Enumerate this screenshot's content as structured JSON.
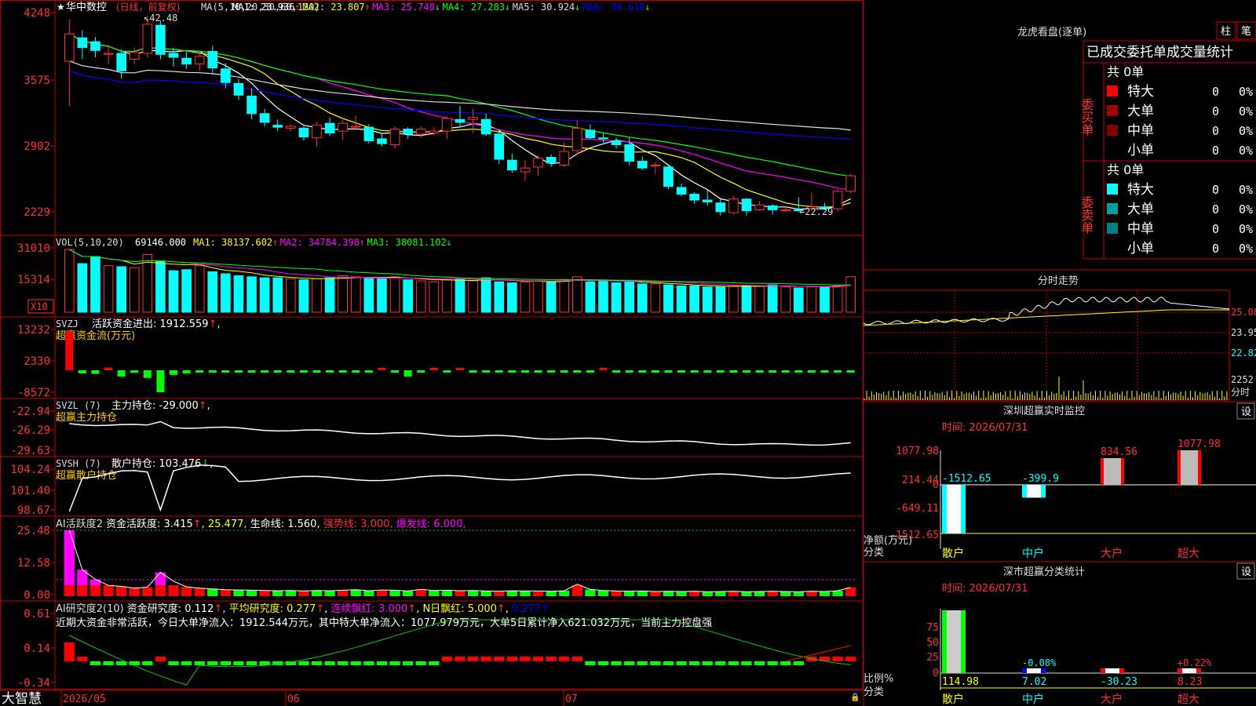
{
  "stock": {
    "name": "华中数控",
    "period": "(日线，前复权)"
  },
  "main_panel": {
    "ma_label": "MA(5,10,20,30,60,120)",
    "ma_items": [
      {
        "name": "MA1",
        "value": "23.936",
        "arrow": "↑",
        "color": "#ffffff"
      },
      {
        "name": "MA2",
        "value": "23.807",
        "arrow": "↑",
        "color": "#ffff00"
      },
      {
        "name": "MA3",
        "value": "25.748",
        "arrow": "↓",
        "color": "#ff00ff"
      },
      {
        "name": "MA4",
        "value": "27.283",
        "arrow": "↓",
        "color": "#00ff00"
      },
      {
        "name": "MA5",
        "value": "30.924",
        "arrow": "↓",
        "color": "#dddddd"
      },
      {
        "name": "MA6",
        "value": "30.610",
        "arrow": "↓",
        "color": "#0000ff"
      }
    ],
    "ticks": [
      "4248",
      "3575",
      "2902",
      "2229"
    ],
    "high_label": "42.48",
    "low_label": "←22.29"
  },
  "vol_panel": {
    "label": "VOL(5,10,20)",
    "value": "69146.000",
    "items": [
      {
        "name": "MA1",
        "value": "38137.602",
        "arrow": "↑",
        "color": "#ffff00"
      },
      {
        "name": "MA2",
        "value": "34784.398",
        "arrow": "↑",
        "color": "#ff00ff"
      },
      {
        "name": "MA3",
        "value": "38081.102",
        "arrow": "↓",
        "color": "#00ff00"
      }
    ],
    "ticks": [
      "31010",
      "15314"
    ],
    "unit_label": "X10"
  },
  "svzj_panel": {
    "label": "SVZJ",
    "name": "活跃资金进出",
    "value": "1912.559",
    "arrow": "↑",
    "subtitle": "超赢资金流(万元)",
    "ticks": [
      "13232",
      "2330",
      "-8572"
    ]
  },
  "svzl_panel": {
    "label": "SVZL (7)",
    "name": "主力持仓",
    "value": "-29.000",
    "arrow": "↑",
    "subtitle": "超赢主力持仓",
    "ticks": [
      "-22.94",
      "-26.29",
      "-29.63"
    ]
  },
  "svsh_panel": {
    "label": "SVSH (7)",
    "name": "散户持仓",
    "value": "103.476",
    "arrow": "↓",
    "subtitle": "超赢散户持仓",
    "ticks": [
      "104.24",
      "101.40",
      "98.67"
    ]
  },
  "ai1_panel": {
    "label": "AI活跃度2",
    "name": "资金活跃度",
    "value": "3.415",
    "value2": "25.477",
    "life_label": "生命线",
    "life_value": "1.560",
    "strong_label": "强势线",
    "strong_value": "3.000",
    "burst_label": "爆发线",
    "burst_value": "6.000",
    "ticks": [
      "25.48",
      "12.58",
      "0.00"
    ]
  },
  "ai2_panel": {
    "label": "AI研究度2(10)",
    "name": "资金研究度",
    "value": "0.112",
    "avg_label": "平均研究度",
    "avg_value": "0.277",
    "red_label": "连续飘红",
    "red_value": "3.000",
    "nred_label": "N日飘红",
    "nred_value": "5.000",
    "last_value": "0.277",
    "comment": "近期大资金非常活跃，今日大单净流入：1912.544万元，其中特大单净流入：1077.979万元，大单5日累计净入621.032万元，当前主力控盘强",
    "ticks": [
      "0.61",
      "0.14",
      "-0.34"
    ]
  },
  "xaxis": {
    "labels": [
      "2026/05",
      "06",
      "07"
    ]
  },
  "brand": "大智慧",
  "right": {
    "lhb_title": "龙虎看盘(逐单)",
    "btn1": "柱",
    "btn2": "笔",
    "table_title": "已成交委托单成交量统计",
    "buy_label": "委买单",
    "sell_label": "委卖单",
    "buy_total": "共 0单",
    "sell_total": "共 0单",
    "buy_rows": [
      {
        "label": "特大",
        "count": "0",
        "pct": "0%",
        "color": "#ff0000"
      },
      {
        "label": "大单",
        "count": "0",
        "pct": "0%",
        "color": "#a00000"
      },
      {
        "label": "中单",
        "count": "0",
        "pct": "0%",
        "color": "#800000"
      },
      {
        "label": "小单",
        "count": "0",
        "pct": "0%",
        "color": ""
      }
    ],
    "sell_rows": [
      {
        "label": "特大",
        "count": "0",
        "pct": "0%",
        "color": "#00ffff"
      },
      {
        "label": "大单",
        "count": "0",
        "pct": "0%",
        "color": "#00a0a0"
      },
      {
        "label": "中单",
        "count": "0",
        "pct": "0%",
        "color": "#008080"
      },
      {
        "label": "小单",
        "count": "0",
        "pct": "0%",
        "color": ""
      }
    ],
    "intraday_title": "分时走势",
    "intraday_ticks": [
      "25.08",
      "23.95",
      "22.82",
      "2252"
    ],
    "intraday_unit": "分时",
    "monitor_title": "深圳超赢实时监控",
    "monitor_btn": "设",
    "monitor_time": "时间: 2026/07/31",
    "monitor_ticks": [
      "1077.98",
      "214.44",
      "0",
      "-649.11",
      "-1512.65"
    ],
    "monitor_ylabel": "净额(万元)",
    "monitor_xlabel": "分类",
    "stat_title": "深市超赢分类统计",
    "stat_btn": "设",
    "stat_time": "时间: 2026/07/31",
    "stat_ticks": [
      "75",
      "50",
      "25",
      "0"
    ],
    "stat_ylabel": "比例%",
    "stat_xlabel": "分类"
  },
  "chart_data": [
    {
      "type": "candlestick",
      "title": "华中数控",
      "high": 42.48,
      "low": 22.29,
      "ohlc": [
        [
          37.8,
          42.1,
          33.2,
          40.6
        ],
        [
          40.2,
          41.0,
          38.0,
          39.2
        ],
        [
          39.8,
          40.3,
          38.2,
          38.9
        ],
        [
          38.5,
          39.5,
          37.5,
          38.6
        ],
        [
          38.6,
          39.0,
          36.0,
          36.8
        ],
        [
          38.0,
          39.2,
          37.5,
          38.7
        ],
        [
          38.6,
          42.48,
          38.2,
          41.6
        ],
        [
          41.5,
          42.0,
          38.0,
          38.5
        ],
        [
          38.6,
          39.2,
          37.2,
          38.2
        ],
        [
          38.1,
          38.8,
          37.0,
          37.5
        ],
        [
          37.5,
          38.6,
          36.8,
          38.3
        ],
        [
          38.8,
          39.4,
          36.4,
          37.1
        ],
        [
          37.0,
          37.6,
          35.0,
          35.6
        ],
        [
          35.5,
          36.0,
          33.8,
          34.3
        ],
        [
          34.2,
          35.0,
          31.8,
          32.4
        ],
        [
          32.4,
          32.9,
          31.1,
          31.5
        ],
        [
          31.2,
          31.8,
          30.6,
          31.0
        ],
        [
          30.9,
          31.3,
          30.6,
          31.1
        ],
        [
          30.9,
          31.1,
          29.6,
          30.0
        ],
        [
          29.9,
          31.5,
          29.0,
          31.2
        ],
        [
          31.4,
          32.0,
          30.1,
          30.4
        ],
        [
          30.6,
          31.7,
          29.7,
          31.4
        ],
        [
          31.0,
          32.2,
          30.7,
          31.1
        ],
        [
          31.0,
          31.3,
          29.3,
          29.6
        ],
        [
          29.8,
          30.3,
          29.0,
          29.3
        ],
        [
          29.2,
          31.1,
          28.8,
          30.8
        ],
        [
          30.8,
          31.0,
          29.8,
          30.3
        ],
        [
          30.3,
          31.1,
          29.9,
          30.8
        ],
        [
          30.4,
          31.0,
          30.2,
          30.6
        ],
        [
          30.6,
          32.1,
          29.8,
          31.9
        ],
        [
          31.8,
          33.2,
          31.0,
          31.5
        ],
        [
          31.8,
          32.9,
          30.4,
          32.0
        ],
        [
          31.8,
          32.4,
          30.1,
          30.3
        ],
        [
          30.3,
          30.8,
          27.2,
          27.7
        ],
        [
          27.6,
          28.3,
          26.3,
          26.6
        ],
        [
          26.4,
          27.6,
          25.5,
          26.8
        ],
        [
          26.9,
          28.1,
          26.0,
          27.8
        ],
        [
          27.9,
          28.2,
          26.9,
          27.3
        ],
        [
          27.1,
          29.4,
          26.9,
          28.5
        ],
        [
          28.6,
          31.7,
          28.2,
          30.9
        ],
        [
          30.7,
          31.3,
          29.8,
          29.9
        ],
        [
          29.9,
          30.4,
          29.4,
          29.8
        ],
        [
          29.6,
          29.9,
          28.8,
          29.2
        ],
        [
          29.2,
          29.9,
          27.1,
          27.5
        ],
        [
          27.5,
          28.0,
          26.6,
          26.8
        ],
        [
          27.1,
          27.4,
          26.2,
          27.1
        ],
        [
          26.9,
          27.2,
          24.6,
          24.9
        ],
        [
          24.8,
          25.2,
          23.9,
          24.1
        ],
        [
          24.1,
          24.3,
          23.1,
          23.5
        ],
        [
          23.5,
          24.6,
          22.9,
          23.3
        ],
        [
          23.2,
          23.6,
          21.9,
          22.3
        ],
        [
          22.2,
          23.9,
          22.0,
          23.6
        ],
        [
          23.6,
          23.7,
          21.9,
          22.4
        ],
        [
          22.5,
          23.4,
          22.4,
          23.0
        ],
        [
          22.9,
          23.1,
          22.0,
          22.5
        ],
        [
          22.4,
          22.9,
          22.29,
          22.5
        ],
        [
          22.5,
          23.8,
          22.3,
          22.4
        ],
        [
          22.6,
          24.3,
          22.4,
          22.8
        ],
        [
          22.8,
          23.2,
          22.5,
          22.6
        ],
        [
          22.6,
          24.6,
          22.3,
          24.4
        ],
        [
          24.4,
          26.2,
          24.2,
          26.0
        ]
      ]
    },
    {
      "type": "bar",
      "title": "VOL(5,10,20)",
      "values": [
        310,
        240,
        275,
        230,
        225,
        220,
        285,
        250,
        205,
        210,
        230,
        200,
        190,
        180,
        175,
        170,
        170,
        165,
        160,
        165,
        170,
        180,
        175,
        170,
        165,
        175,
        160,
        155,
        150,
        160,
        165,
        155,
        170,
        150,
        145,
        150,
        155,
        150,
        160,
        175,
        150,
        155,
        145,
        150,
        140,
        140,
        135,
        130,
        130,
        125,
        125,
        130,
        130,
        130,
        135,
        125,
        120,
        125,
        125,
        130,
        175
      ]
    },
    {
      "type": "bar",
      "title": "SVZJ 活跃资金进出",
      "values": [
        13232,
        -1200,
        -1400,
        900,
        -2500,
        -1000,
        -3000,
        -8572,
        -1800,
        -1300,
        -800,
        -500,
        -300,
        -400,
        -400,
        -300,
        -300,
        -200,
        -400,
        -200,
        -300,
        -300,
        -200,
        -300,
        300,
        -300,
        -2500,
        -200,
        300,
        -300,
        300,
        -300,
        -300,
        -300,
        -300,
        -400,
        -300,
        -300,
        -300,
        -300,
        -400,
        500,
        -300,
        -300,
        -300,
        -300,
        -400,
        -300,
        -300,
        -300,
        -300,
        -300,
        -300,
        -300,
        -300,
        -300,
        -300,
        -300,
        -300,
        -300,
        -200,
        -300,
        800
      ]
    },
    {
      "type": "line",
      "title": "SVZL 主力持仓",
      "ylim": [
        -29.63,
        -22.94
      ]
    },
    {
      "type": "line",
      "title": "SVSH 散户持仓",
      "ylim": [
        98.67,
        104.24
      ]
    },
    {
      "type": "bar",
      "title": "AI活跃度2",
      "values": [
        25.48,
        10.2,
        6.5,
        4.2,
        3.8,
        3.1,
        3.5,
        9.2,
        5.8,
        3.6,
        3.1,
        2.8,
        2.5,
        2.4,
        2.3,
        2.2,
        2.1,
        2.2,
        2.0,
        2.2,
        2.1,
        2.3,
        2.5,
        2.1,
        2.4,
        2.3,
        2.0,
        2.6,
        2.2,
        2.3,
        2.1,
        2.2,
        2.0,
        1.9,
        2.1,
        2.0,
        2.0,
        1.9,
        2.1,
        4.6,
        2.6,
        2.2,
        2.0,
        1.9,
        2.0,
        1.8,
        1.9,
        1.8,
        1.9,
        1.7,
        1.8,
        1.9,
        1.7,
        1.8,
        1.9,
        1.8,
        1.7,
        1.9,
        1.8,
        2.1,
        3.4
      ]
    },
    {
      "type": "bar",
      "title": "深圳超赢实时监控",
      "categories": [
        "散户",
        "中户",
        "大户",
        "超大"
      ],
      "values": [
        -1512.65,
        -399.9,
        834.56,
        1077.98
      ]
    },
    {
      "type": "bar",
      "title": "深市超赢分类统计",
      "categories": [
        "散户",
        "中户",
        "大户",
        "超大"
      ],
      "values": [
        114.98,
        7.02,
        -30.23,
        8.23
      ],
      "labels": [
        "",
        "-0.08%",
        "",
        "+0.22%"
      ]
    }
  ]
}
